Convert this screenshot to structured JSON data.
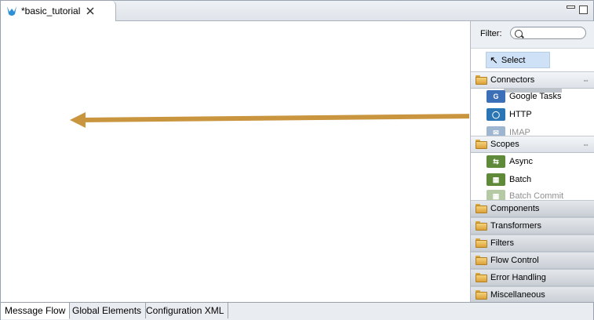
{
  "editor_tab": {
    "title": "*basic_tutorial"
  },
  "palette": {
    "filter_label": "Filter:",
    "filter_value": "",
    "select_label": "Select",
    "drawers": [
      {
        "label": "Connectors",
        "open": true
      },
      {
        "label": "Scopes",
        "open": true
      },
      {
        "label": "Components",
        "open": false
      },
      {
        "label": "Transformers",
        "open": false
      },
      {
        "label": "Filters",
        "open": false
      },
      {
        "label": "Flow Control",
        "open": false
      },
      {
        "label": "Error Handling",
        "open": false
      },
      {
        "label": "Miscellaneous",
        "open": false
      }
    ],
    "connector_items": [
      "Google Tasks",
      "HTTP",
      "IMAP"
    ],
    "scope_items": [
      "Async",
      "Batch",
      "Batch Commit"
    ]
  },
  "bottom_tabs": [
    "Message Flow",
    "Global Elements",
    "Configuration XML"
  ],
  "colors": {
    "arrow": "#c9953f",
    "select_bg": "#cfe1f6"
  }
}
